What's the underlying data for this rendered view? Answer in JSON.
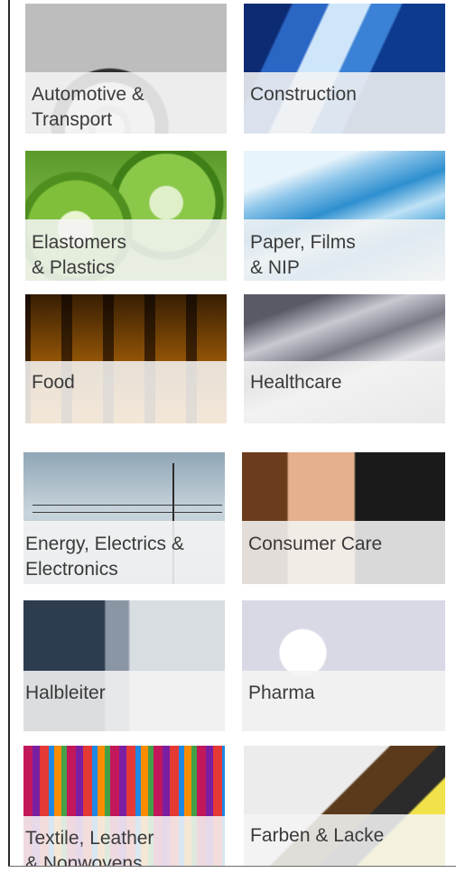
{
  "tiles": [
    {
      "label": "Automotive &\nTransport",
      "image": "car-wheel-photo"
    },
    {
      "label": "Construction",
      "image": "glass-skyscrapers-photo"
    },
    {
      "label": "Elastomers\n& Plastics",
      "image": "green-rubber-rings-photo"
    },
    {
      "label": "Paper, Films\n& NIP",
      "image": "blue-film-wave-photo"
    },
    {
      "label": "Food",
      "image": "bottling-line-photo"
    },
    {
      "label": "Healthcare",
      "image": "syringe-vial-photo"
    },
    {
      "label": "Energy, Electrics &\nElectronics",
      "image": "power-pylon-photo"
    },
    {
      "label": "Consumer Care",
      "image": "woman-portrait-photo"
    },
    {
      "label": "Halbleiter",
      "image": "space-shuttle-launch-photo"
    },
    {
      "label": "Pharma",
      "image": "pills-photo"
    },
    {
      "label": "Textile, Leather\n& Nonwovens",
      "image": "colored-fabrics-photo"
    },
    {
      "label": "Farben & Lacke",
      "image": "paint-brush-photo"
    }
  ]
}
